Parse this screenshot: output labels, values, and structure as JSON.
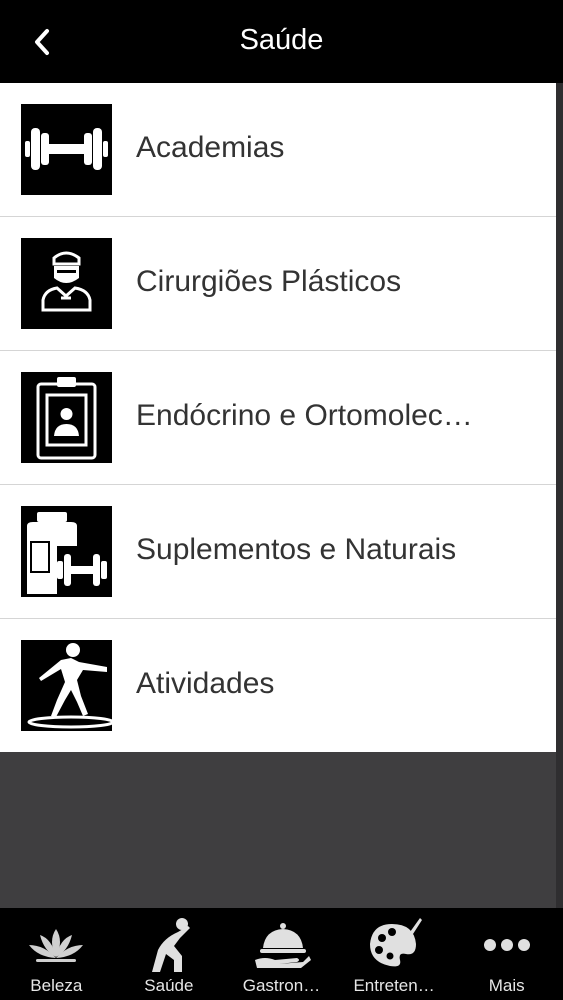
{
  "header": {
    "title": "Saúde",
    "back_icon": "chevron-left-icon"
  },
  "list": {
    "items": [
      {
        "label": "Academias",
        "icon": "dumbbell-icon"
      },
      {
        "label": "Cirurgiões Plásticos",
        "icon": "surgeon-icon"
      },
      {
        "label": "Endócrino e Ortomolec…",
        "icon": "clipboard-icon"
      },
      {
        "label": "Suplementos e Naturais",
        "icon": "supplement-icon"
      },
      {
        "label": "Atividades",
        "icon": "stretching-person-icon"
      }
    ]
  },
  "tabbar": {
    "tabs": [
      {
        "label": "Beleza",
        "icon": "lotus-icon"
      },
      {
        "label": "Saúde",
        "icon": "stretching-icon"
      },
      {
        "label": "Gastron…",
        "icon": "cloche-icon"
      },
      {
        "label": "Entreten…",
        "icon": "palette-icon"
      },
      {
        "label": "Mais",
        "icon": "more-dots-icon"
      }
    ]
  },
  "colors": {
    "header_bg": "#000000",
    "list_bg": "#ffffff",
    "empty_area_bg": "#3f3e40",
    "tabbar_bg": "#000000",
    "row_text": "#333333"
  }
}
